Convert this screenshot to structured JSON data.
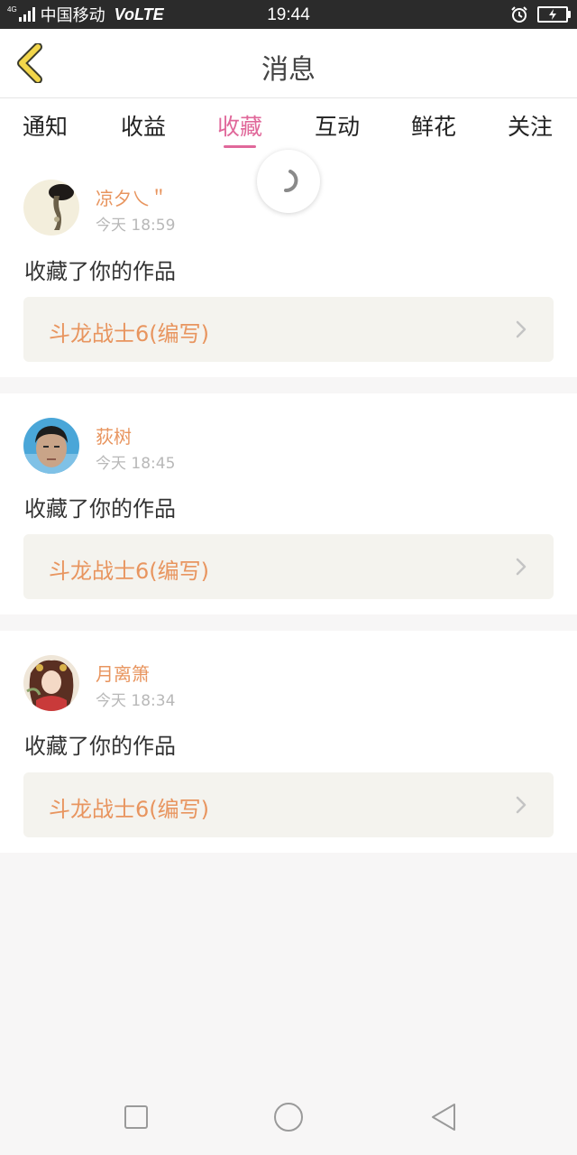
{
  "status_bar": {
    "network": "4G",
    "carrier": "中国移动",
    "volte": "VoLTE",
    "time": "19:44"
  },
  "header": {
    "title": "消息"
  },
  "tabs": [
    {
      "label": "通知",
      "active": false
    },
    {
      "label": "收益",
      "active": false
    },
    {
      "label": "收藏",
      "active": true
    },
    {
      "label": "互动",
      "active": false
    },
    {
      "label": "鲜花",
      "active": false
    },
    {
      "label": "关注",
      "active": false
    }
  ],
  "notifications": [
    {
      "username": "凉夕乀＂",
      "time": "今天 18:59",
      "action": "收藏了你的作品",
      "work_title": "斗龙战士6(编写)"
    },
    {
      "username": "荻树",
      "time": "今天 18:45",
      "action": "收藏了你的作品",
      "work_title": "斗龙战士6(编写)"
    },
    {
      "username": "月离箫",
      "time": "今天 18:34",
      "action": "收藏了你的作品",
      "work_title": "斗龙战士6(编写)"
    }
  ],
  "colors": {
    "accent_pink": "#e0689a",
    "username_orange": "#e8955f",
    "back_arrow_yellow": "#f2d64a"
  },
  "icons": {
    "back": "chevron-left-icon",
    "spinner": "loading-spinner-icon",
    "nav_recent": "square-icon",
    "nav_home": "circle-icon",
    "nav_back": "triangle-back-icon"
  }
}
